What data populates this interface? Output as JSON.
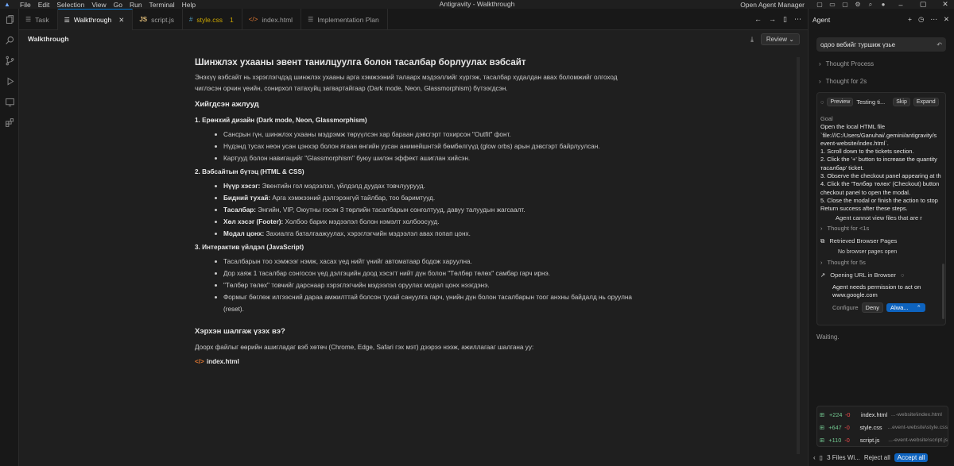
{
  "titlebar": {
    "menu": [
      "File",
      "Edit",
      "Selection",
      "View",
      "Go",
      "Run",
      "Terminal",
      "Help"
    ],
    "title": "Antigravity - Walkthrough",
    "open_agent_manager": "Open Agent Manager"
  },
  "tabs": [
    {
      "label": "Task",
      "icon": "list-icon"
    },
    {
      "label": "Walkthrough",
      "icon": "list-icon",
      "active": true
    },
    {
      "label": "script.js",
      "icon": "js-icon",
      "badge": ""
    },
    {
      "label": "style.css",
      "icon": "css-icon",
      "badge": "1"
    },
    {
      "label": "index.html",
      "icon": "html-icon"
    },
    {
      "label": "Implementation Plan",
      "icon": "list-icon"
    }
  ],
  "editor": {
    "header_title": "Walkthrough",
    "review_label": "Review",
    "doc": {
      "title": "Шинжлэх ухааны эвент танилцуулга болон тасалбар борлуулах вэбсайт",
      "intro": "Энэхүү вэбсайт нь хэрэглэгчдэд шинжлэх ухааны арга хэмжээний талаарх мэдээллийг хүргэж, тасалбар худалдан авах боломжийг олгоход чиглэсэн орчин үеийн, сонирхол татахуйц загвартайгаар (Dark mode, Neon, Glassmorphism) бүтээгдсэн.",
      "features_heading": "Хийгдсэн ажлууд",
      "sections": [
        {
          "title": "1. Ерөнхий дизайн (Dark mode, Neon, Glassmorphism)",
          "items": [
            {
              "bold": "",
              "text": "Сансрын гүн, шинжлэх ухааны мэдрэмж төрүүлсэн хар бараан дэвсгэрт тохирсон \"Outfit\" фонт."
            },
            {
              "bold": "",
              "text": "Нүдэнд тусах неон усан цэнхэр болон ягаан өнгийн уусан анимейшнтэй бөмбөлгүүд (glow orbs) арын дэвсгэрт байрлуулсан."
            },
            {
              "bold": "",
              "text": "Картууд болон навигацийг \"Glassmorphism\" буюу шилэн эффект ашиглан хийсэн."
            }
          ]
        },
        {
          "title": "2. Вэбсайтын бүтэц (HTML & CSS)",
          "items": [
            {
              "bold": "Нүүр хэсэг:",
              "text": " Эвентийн гол мэдээлэл, үйлдэлд дуудах товчлуурууд."
            },
            {
              "bold": "Бидний тухай:",
              "text": " Арга хэмжээний дэлгэрэнгүй тайлбар, тоо баримтууд."
            },
            {
              "bold": "Тасалбар:",
              "text": " Энгийн, VIP, Оюутны гэсэн 3 төрлийн тасалбарын сонголтууд, давуу талуудын жагсаалт."
            },
            {
              "bold": "Хөл хэсэг (Footer):",
              "text": " Холбоо барих мэдээлэл болон нэмэлт холбоосууд."
            },
            {
              "bold": "Модал цонх:",
              "text": " Захиалга баталгаажуулах, хэрэглэгчийн мэдээлэл авах попап цонх."
            }
          ]
        },
        {
          "title": "3. Интерактив үйлдэл (JavaScript)",
          "items": [
            {
              "bold": "",
              "text": "Тасалбарын тоо хэмжээг нэмж, хасах үед нийт үнийг автоматаар бодож харуулна."
            },
            {
              "bold": "",
              "text": "Дор хаяж 1 тасалбар сонгосон үед дэлгэцийн доод хэсэгт нийт дүн болон \"Төлбөр төлөх\" самбар гарч ирнэ."
            },
            {
              "bold": "",
              "text": "\"Төлбөр төлөх\" товчийг дарснаар хэрэглэгчийн мэдээлэл оруулах модал цонх нээгдэнэ."
            },
            {
              "bold": "",
              "text": "Формыг бөглөж илгээсний дараа амжилттай болсон тухай сануулга гарч, үнийн дүн болон тасалбарын тоог анхны байдалд нь оруулна (reset)."
            }
          ]
        }
      ],
      "check_heading": "Хэрхэн шалгаж үзэх вэ?",
      "check_text": "Доорх файлыг өөрийн ашигладаг вэб хөтөч (Chrome, Edge, Safari гэх мэт) дээрээ нээж, ажиллагааг шалгана уу:",
      "file_link": "index.html"
    }
  },
  "agent": {
    "title": "Agent",
    "query": "одоо вебийг туршиж үзье",
    "thought_process": "Thought Process",
    "thought_for_2s": "Thought for 2s",
    "card": {
      "preview": "Preview",
      "testing": "Testing ti...",
      "skip": "Skip",
      "expand": "Expand",
      "goal_label": "Goal",
      "goal_lines": [
        "Open the local HTML file",
        "`file:///C:/Users/Ganuhai/.gemini/antigravity/s",
        "event-website/index.html`.",
        "1. Scroll down to the tickets section.",
        "2. Click the '+' button to increase the quantity",
        "тасалбар' ticket.",
        "3. Observe the checkout panel appearing at th",
        "4. Click the 'Төлбөр төлөх' (Checkout) button",
        "checkout panel to open the modal.",
        "5. Close the modal or finish the action to stop",
        "Return success after these steps."
      ],
      "cannot_view": "Agent cannot view files that are r",
      "thought_1s": "Thought for <1s",
      "retrieved": "Retrieved Browser Pages",
      "no_pages": "No browser pages open",
      "thought_5s": "Thought for 5s",
      "opening_url": "Opening URL in Browser",
      "permission": "Agent needs permission to act on www.google.com",
      "configure": "Configure",
      "deny": "Deny",
      "allow": "Alwa..."
    },
    "waiting": "Waiting.",
    "files": [
      {
        "add": "+224",
        "rem": "-0",
        "name": "index.html",
        "path": "...-website\\index.html"
      },
      {
        "add": "+647",
        "rem": "-0",
        "name": "style.css",
        "path": "...event-website\\style.css"
      },
      {
        "add": "+110",
        "rem": "-0",
        "name": "script.js",
        "path": "...-event-website\\script.js"
      }
    ],
    "bottom": {
      "files_label": "3 Files Wi...",
      "reject_all": "Reject all",
      "accept_all": "Accept all"
    }
  }
}
